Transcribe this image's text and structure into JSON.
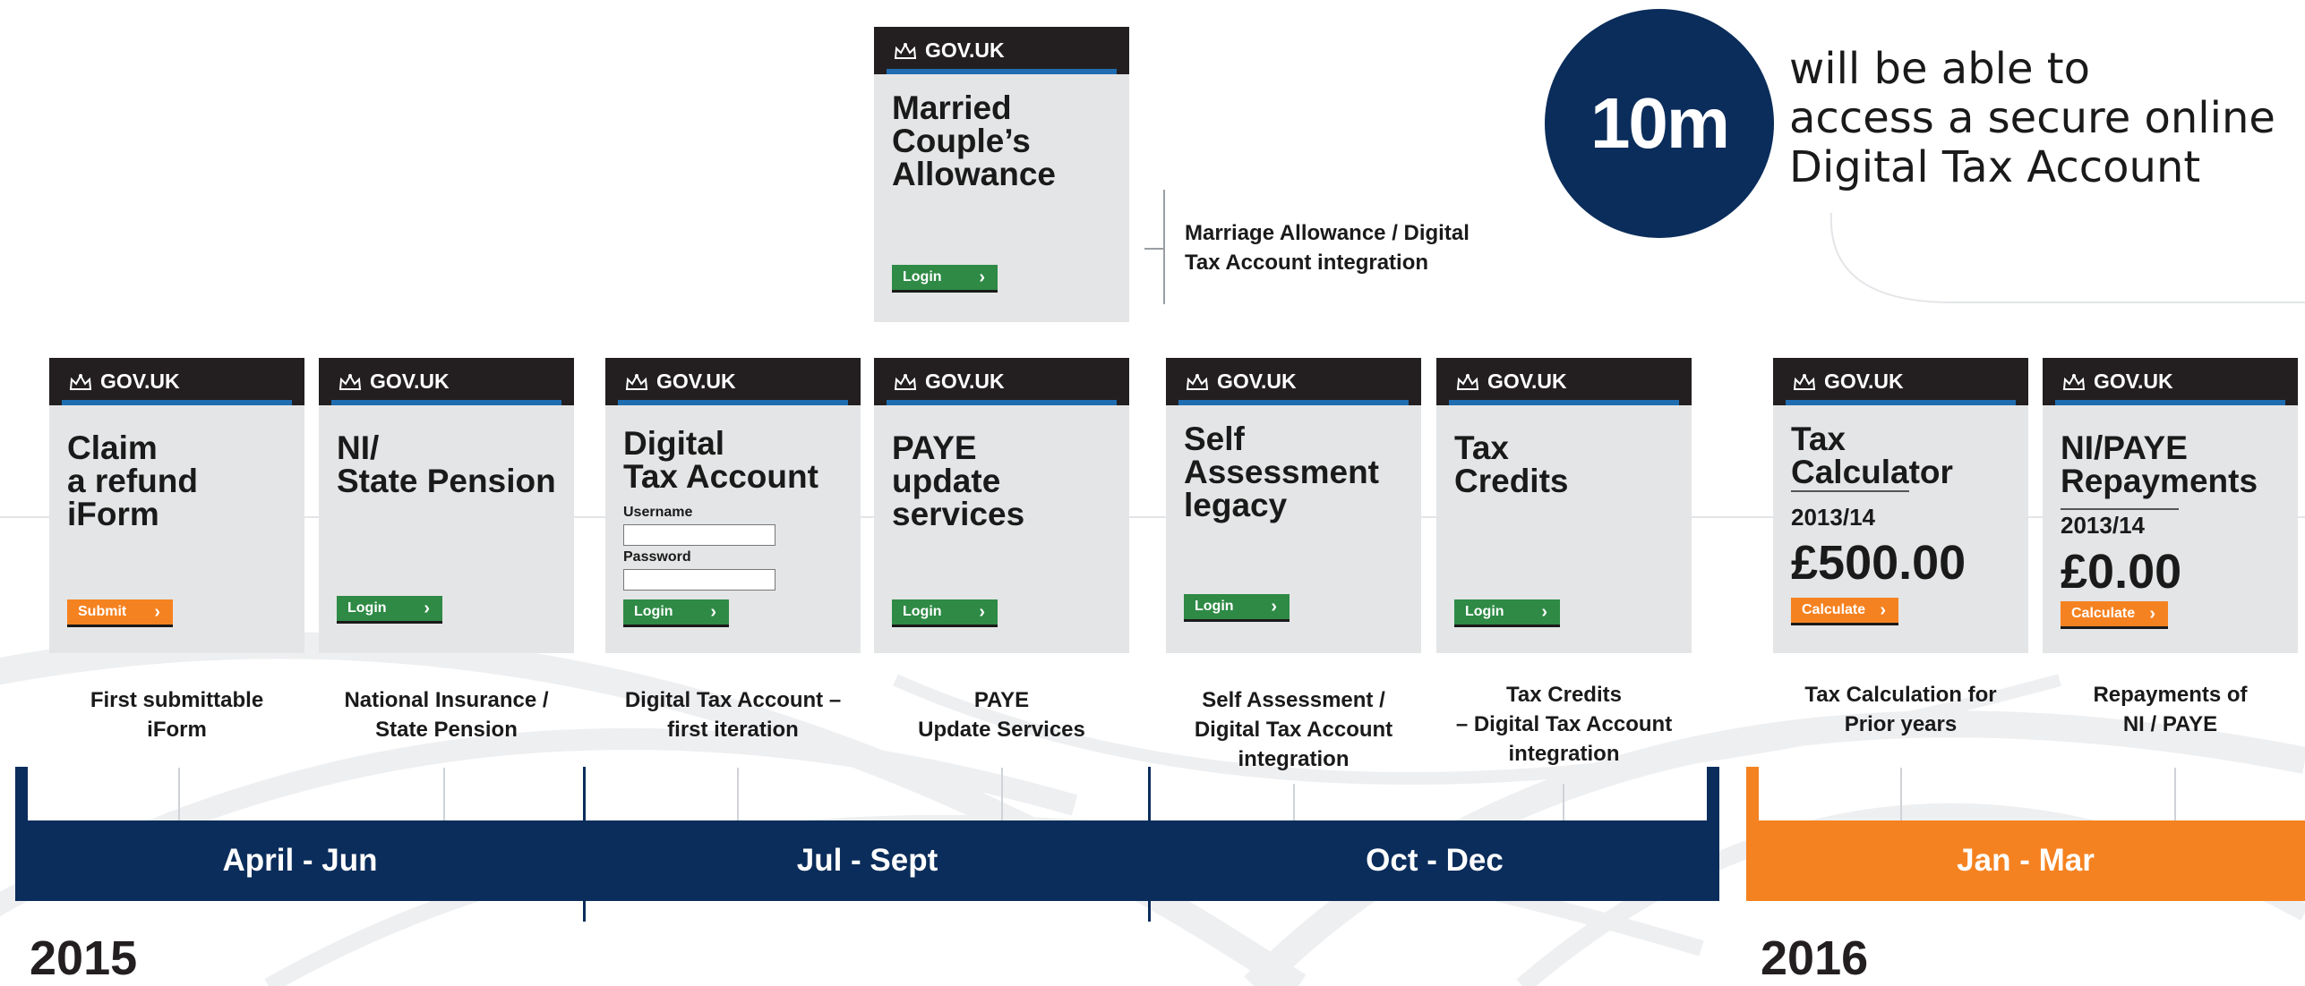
{
  "colors": {
    "navy": "#0b2d5b",
    "orange": "#f58220",
    "green": "#2e8a45",
    "card_bg": "#e4e5e6",
    "header": "#231f20",
    "stripe": "#1f6db0"
  },
  "brand": "GOV.UK",
  "top_card": {
    "title": "Married\nCouple’s\nAllowance",
    "button": "Login",
    "caption": "Marriage Allowance / Digital\nTax Account integration"
  },
  "stat": {
    "value": "10m",
    "text": "will be able to\naccess a secure online\nDigital Tax Account"
  },
  "cards": [
    {
      "title": "Claim\na refund\niForm",
      "button": "Submit",
      "caption": "First  submittable\niForm"
    },
    {
      "title": "NI/\nState Pension",
      "button": "Login",
      "caption": "National Insurance /\nState Pension"
    },
    {
      "title": "Digital\nTax Account",
      "username_label": "Username",
      "password_label": "Password",
      "button": "Login",
      "caption": "Digital Tax Account –\nfirst iteration"
    },
    {
      "title": "PAYE\nupdate\nservices",
      "button": "Login",
      "caption": "PAYE\nUpdate Services"
    },
    {
      "title": "Self\nAssessment\nlegacy",
      "button": "Login",
      "caption": "Self Assessment /\nDigital Tax Account\nintegration"
    },
    {
      "title": "Tax\nCredits",
      "button": "Login",
      "caption": "Tax Credits\n– Digital Tax Account\nintegration"
    },
    {
      "title": "Tax\nCalculator",
      "year": "2013/14",
      "amount": "£500.00",
      "button": "Calculate",
      "caption": "Tax Calculation for\nPrior years"
    },
    {
      "title": "NI/PAYE\nRepayments",
      "year": "2013/14",
      "amount": "£0.00",
      "button": "Calculate",
      "caption": "Repayments of\nNI / PAYE"
    }
  ],
  "quarters": [
    {
      "label": "April - Jun"
    },
    {
      "label": "Jul - Sept"
    },
    {
      "label": "Oct - Dec"
    },
    {
      "label": "Jan - Mar"
    }
  ],
  "years": [
    "2015",
    "2016"
  ]
}
